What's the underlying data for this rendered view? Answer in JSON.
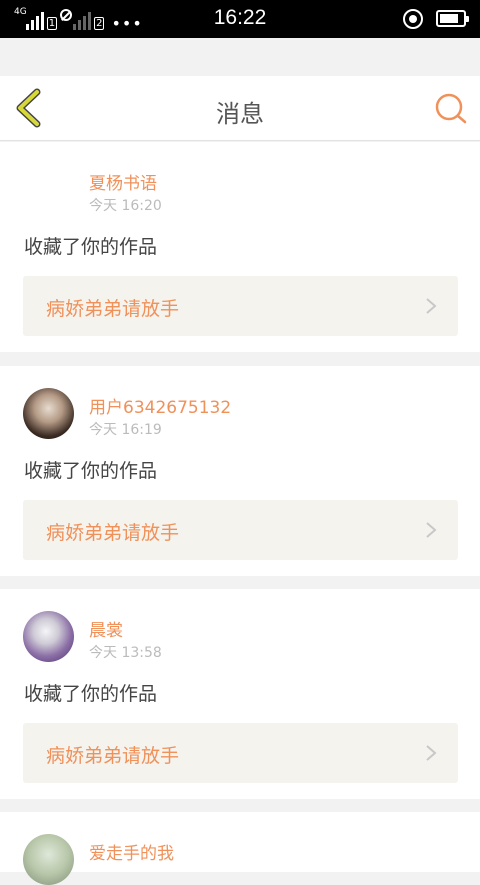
{
  "status_bar": {
    "network": "4G",
    "sim1": "1",
    "sim2": "2",
    "more": "•••",
    "time": "16:22",
    "battery_level": 0.8
  },
  "header": {
    "title": "消息",
    "back_icon": "chevron-left-icon",
    "search_icon": "search-icon"
  },
  "messages": [
    {
      "user": "夏杨书语",
      "time": "今天 16:20",
      "action": "收藏了你的作品",
      "work": "病娇弟弟请放手"
    },
    {
      "user": "用户6342675132",
      "time": "今天 16:19",
      "action": "收藏了你的作品",
      "work": "病娇弟弟请放手"
    },
    {
      "user": "晨裳",
      "time": "今天 13:58",
      "action": "收藏了你的作品",
      "work": "病娇弟弟请放手"
    },
    {
      "user": "爱走手的我"
    }
  ],
  "colors": {
    "accent": "#f0915a",
    "back_icon": "#d7d93a"
  }
}
